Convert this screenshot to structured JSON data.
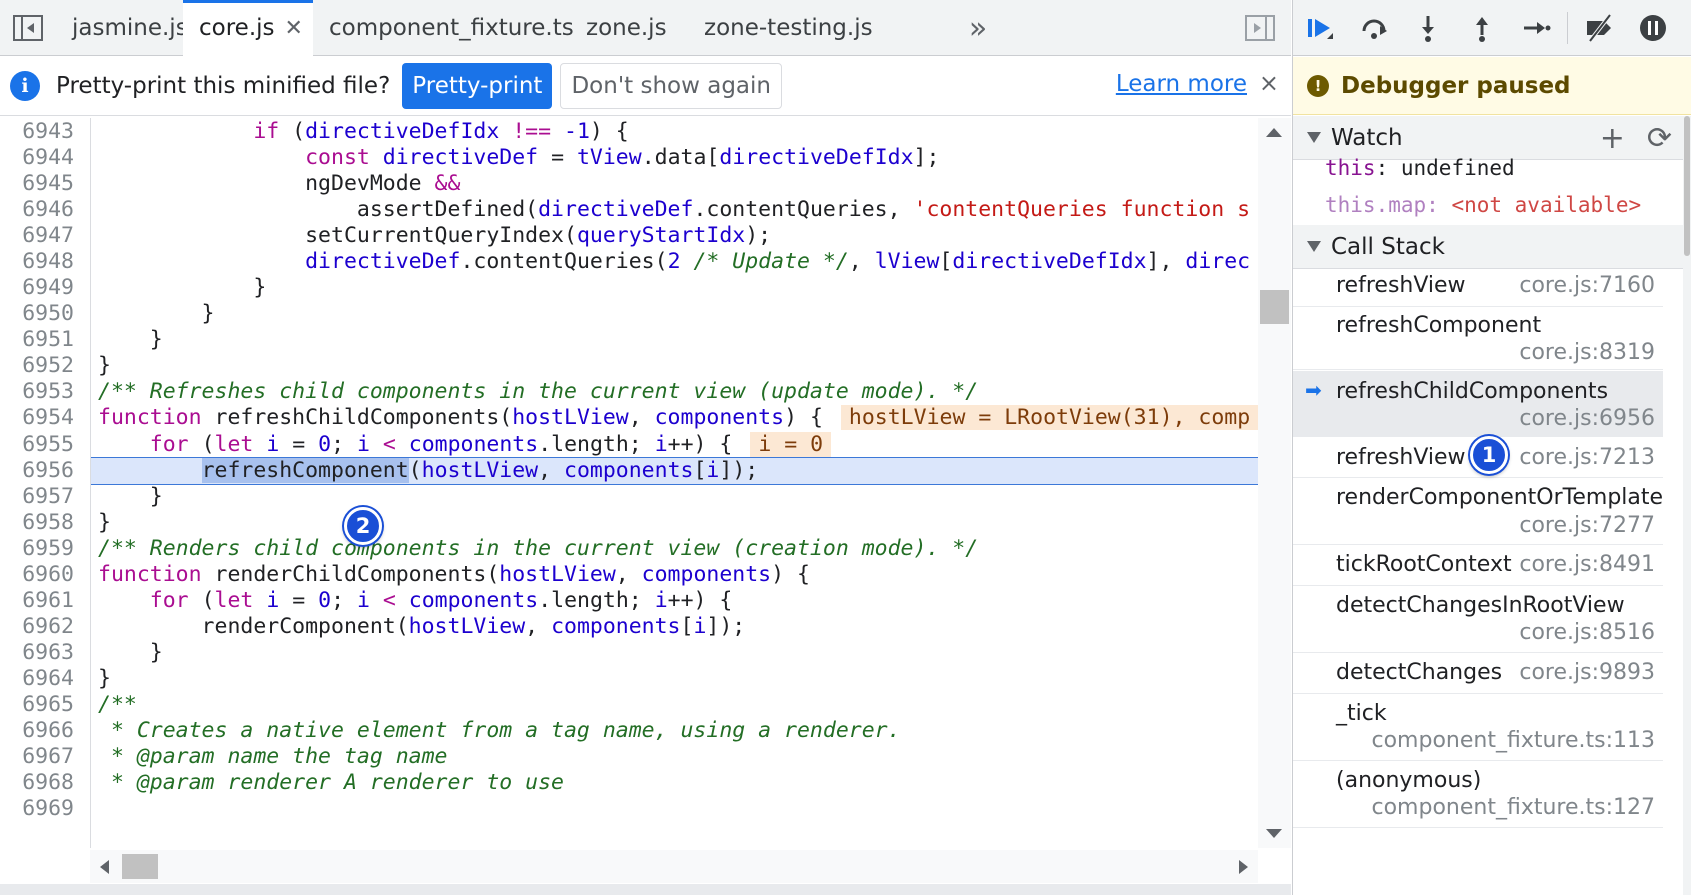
{
  "tabs": [
    {
      "label": "jasmine.js",
      "active": false
    },
    {
      "label": "core.js",
      "active": true
    },
    {
      "label": "component_fixture.ts",
      "active": false
    },
    {
      "label": "zone.js",
      "active": false
    },
    {
      "label": "zone-testing.js",
      "active": false
    }
  ],
  "more_tabs_glyph": "»",
  "infobar": {
    "message": "Pretty-print this minified file?",
    "primary_button": "Pretty-print",
    "secondary_button": "Don't show again",
    "learn_more": "Learn more",
    "close_glyph": "×"
  },
  "code_lines": [
    {
      "n": "6943"
    },
    {
      "n": "6944"
    },
    {
      "n": "6945"
    },
    {
      "n": "6946"
    },
    {
      "n": "6947"
    },
    {
      "n": "6948"
    },
    {
      "n": "6949"
    },
    {
      "n": "6950"
    },
    {
      "n": "6951"
    },
    {
      "n": "6952"
    },
    {
      "n": "6953"
    },
    {
      "n": "6954"
    },
    {
      "n": "6955"
    },
    {
      "n": "6956"
    },
    {
      "n": "6957"
    },
    {
      "n": "6958"
    },
    {
      "n": "6959"
    },
    {
      "n": "6960"
    },
    {
      "n": "6961"
    },
    {
      "n": "6962"
    },
    {
      "n": "6963"
    },
    {
      "n": "6964"
    },
    {
      "n": "6965"
    },
    {
      "n": "6966"
    },
    {
      "n": "6967"
    },
    {
      "n": "6968"
    },
    {
      "n": "6969"
    }
  ],
  "code": {
    "l6943": "            if (directiveDefIdx !== -1) {",
    "l6944a": "                const ",
    "l6944b": "directiveDef",
    "l6944c": " = ",
    "l6944d": "tView",
    "l6944e": ".data[",
    "l6944f": "directiveDefIdx",
    "l6944g": "];",
    "l6945a": "                ngDevMode ",
    "l6945b": "&&",
    "l6946a": "                    assertDefined(",
    "l6946b": "directiveDef",
    "l6946c": ".contentQueries, ",
    "l6946d": "'contentQueries function s",
    "l6947a": "                setCurrentQueryIndex(",
    "l6947b": "queryStartIdx",
    "l6947c": ");",
    "l6948a": "                ",
    "l6948b": "directiveDef",
    "l6948c": ".contentQueries(",
    "l6948d": "2",
    "l6948e": " /* Update */",
    "l6948f": ", ",
    "l6948g": "lView",
    "l6948h": "[",
    "l6948i": "directiveDefIdx",
    "l6948j": "], ",
    "l6948k": "direc",
    "l6949": "            }",
    "l6950": "        }",
    "l6951": "    }",
    "l6952": "}",
    "l6953": "/** Refreshes child components in the current view (update mode). */",
    "l6954a": "function ",
    "l6954b": "refreshChildComponents(",
    "l6954c": "hostLView",
    "l6954d": ", ",
    "l6954e": "components",
    "l6954f": ") {",
    "l6954val": "hostLView = LRootView(31), comp",
    "l6955a": "    ",
    "l6955b": "for",
    "l6955c": " (",
    "l6955d": "let",
    "l6955e": " ",
    "l6955f": "i",
    "l6955g": " = ",
    "l6955h": "0",
    "l6955i": "; ",
    "l6955j": "i",
    "l6955k": " < ",
    "l6955l": "components",
    "l6955m": ".length; ",
    "l6955n": "i",
    "l6955o": "++) {",
    "l6955val": "i = 0",
    "l6956a": "        ",
    "l6956b": "refreshComponent",
    "l6956c": "(",
    "l6956d": "hostLView",
    "l6956e": ", ",
    "l6956f": "components",
    "l6956g": "[",
    "l6956h": "i",
    "l6956i": "]);",
    "l6957": "    }",
    "l6958": "}",
    "l6959": "/** Renders child components in the current view (creation mode). */",
    "l6960a": "function ",
    "l6960b": "renderChildComponents(",
    "l6960c": "hostLView",
    "l6960d": ", ",
    "l6960e": "components",
    "l6960f": ") {",
    "l6961a": "    ",
    "l6961b": "for",
    "l6961c": " (",
    "l6961d": "let",
    "l6961e": " ",
    "l6961f": "i",
    "l6961g": " = ",
    "l6961h": "0",
    "l6961i": "; ",
    "l6961j": "i",
    "l6961k": " < ",
    "l6961l": "components",
    "l6961m": ".length; ",
    "l6961n": "i",
    "l6961o": "++) {",
    "l6962a": "        renderComponent(",
    "l6962b": "hostLView",
    "l6962c": ", ",
    "l6962d": "components",
    "l6962e": "[",
    "l6962f": "i",
    "l6962g": "]);",
    "l6963": "    }",
    "l6964": "}",
    "l6965": "/**",
    "l6966": " * Creates a native element from a tag name, using a renderer.",
    "l6967": " * @param name the tag name",
    "l6968": " * @param renderer A renderer to use"
  },
  "badges": {
    "one": "1",
    "two": "2"
  },
  "debugger": {
    "paused_label": "Debugger paused",
    "paused_icon": "!",
    "watch_title": "Watch",
    "add_glyph": "+",
    "refresh_glyph": "⟳",
    "watch": [
      {
        "name": "this",
        "sep": ": ",
        "value": "undefined"
      },
      {
        "name": "this.map",
        "sep": ": ",
        "value": "<not available>"
      }
    ],
    "callstack_title": "Call Stack",
    "frames": [
      {
        "name": "refreshView",
        "loc": "core.js:7160"
      },
      {
        "name": "refreshComponent",
        "loc": "core.js:8319"
      },
      {
        "name": "refreshChildComponents",
        "loc": "core.js:6956"
      },
      {
        "name": "refreshView",
        "loc": "core.js:7213"
      },
      {
        "name": "renderComponentOrTemplate",
        "loc": "core.js:7277"
      },
      {
        "name": "tickRootContext",
        "loc": "core.js:8491"
      },
      {
        "name": "detectChangesInRootView",
        "loc": "core.js:8516"
      },
      {
        "name": "detectChanges",
        "loc": "core.js:9893"
      },
      {
        "name": "_tick",
        "loc": "component_fixture.ts:113"
      },
      {
        "name": "(anonymous)",
        "loc": "component_fixture.ts:127"
      }
    ],
    "current_frame_arrow": "➡"
  },
  "colors": {
    "accent": "#1a73e8",
    "paused_bg": "#fffbe5",
    "highlight_row": "#dbe6fb",
    "badge": "#1a4fd6"
  }
}
